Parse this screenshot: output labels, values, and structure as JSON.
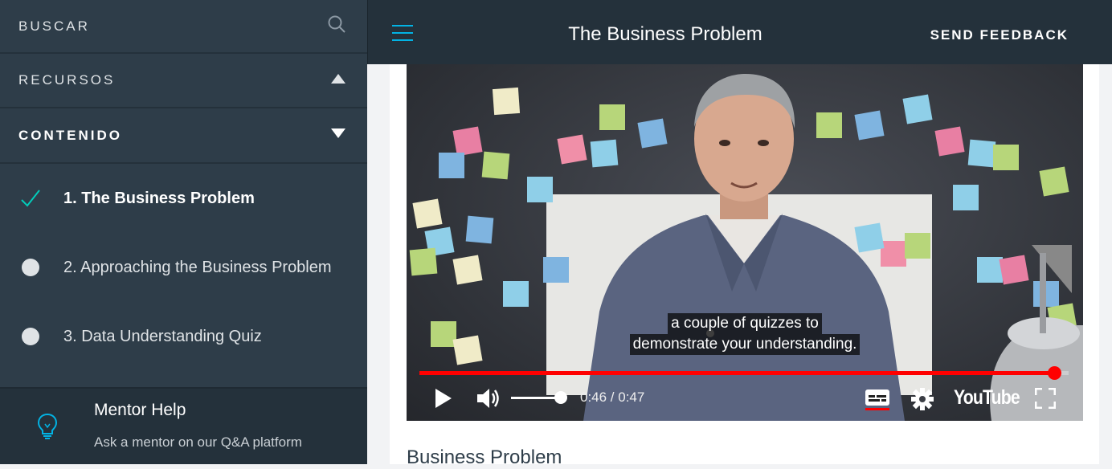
{
  "sidebar": {
    "search_label": "BUSCAR",
    "resources_label": "RECURSOS",
    "contents_label": "CONTENIDO",
    "lessons": [
      {
        "label": "1. The Business Problem",
        "status": "completed"
      },
      {
        "label": "2. Approaching the Business Problem",
        "status": "pending"
      },
      {
        "label": "3. Data Understanding Quiz",
        "status": "pending"
      }
    ],
    "mentor": {
      "title": "Mentor Help",
      "subtitle": "Ask a mentor on our Q&A platform"
    }
  },
  "header": {
    "title": "The Business Problem",
    "feedback_label": "SEND FEEDBACK"
  },
  "video": {
    "caption_line1": "a couple of quizzes to",
    "caption_line2": "demonstrate your understanding.",
    "time": "0:46 / 0:47",
    "progress": 0.978,
    "volume": 0.85,
    "brand": "YouTube"
  },
  "content": {
    "heading": "Business Problem"
  },
  "colors": {
    "accent": "#02b3e4",
    "check": "#02ccba",
    "progress": "#ff0000",
    "sidebar_bg": "#2e3d49",
    "header_bg": "#24313b"
  }
}
